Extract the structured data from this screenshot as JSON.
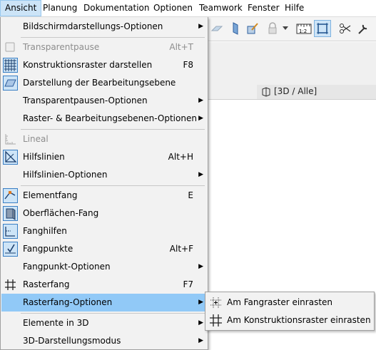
{
  "menubar": {
    "items": [
      "Ansicht",
      "Planung",
      "Dokumentation",
      "Optionen",
      "Teamwork",
      "Fenster",
      "Hilfe"
    ]
  },
  "view_tab": {
    "label": "[3D / Alle]"
  },
  "menu": {
    "items": [
      {
        "label": "Bildschirmdarstellungs-Optionen",
        "shortcut": "",
        "submenu": true
      },
      {
        "label": "Transparentpause",
        "shortcut": "Alt+T",
        "disabled": true
      },
      {
        "label": "Konstruktionsraster darstellen",
        "shortcut": "F8"
      },
      {
        "label": "Darstellung der Bearbeitungsebene",
        "shortcut": ""
      },
      {
        "label": "Transparentpausen-Optionen",
        "submenu": true
      },
      {
        "label": "Raster- & Bearbeitungsebenen-Optionen",
        "submenu": true
      },
      {
        "label": "Lineal",
        "disabled": true
      },
      {
        "label": "Hilfslinien",
        "shortcut": "Alt+H"
      },
      {
        "label": "Hilfslinien-Optionen",
        "submenu": true
      },
      {
        "label": "Elementfang",
        "shortcut": "E"
      },
      {
        "label": "Oberflächen-Fang",
        "shortcut": ""
      },
      {
        "label": "Fanghilfen",
        "shortcut": ""
      },
      {
        "label": "Fangpunkte",
        "shortcut": "Alt+F"
      },
      {
        "label": "Fangpunkt-Optionen",
        "submenu": true
      },
      {
        "label": "Rasterfang",
        "shortcut": "F7"
      },
      {
        "label": "Rasterfang-Optionen",
        "submenu": true,
        "highlighted": true
      },
      {
        "label": "Elemente in 3D",
        "submenu": true
      },
      {
        "label": "3D-Darstellungsmodus",
        "submenu": true
      }
    ]
  },
  "submenu": {
    "items": [
      {
        "label": "Am Fangraster einrasten"
      },
      {
        "label": "Am Konstruktionsraster einrasten"
      }
    ]
  },
  "colors": {
    "highlight": "#91c9f7",
    "menu_bg": "#f2f2f2",
    "disabled_text": "#8d8d8d",
    "icon_blue": "#3a7fc4"
  }
}
